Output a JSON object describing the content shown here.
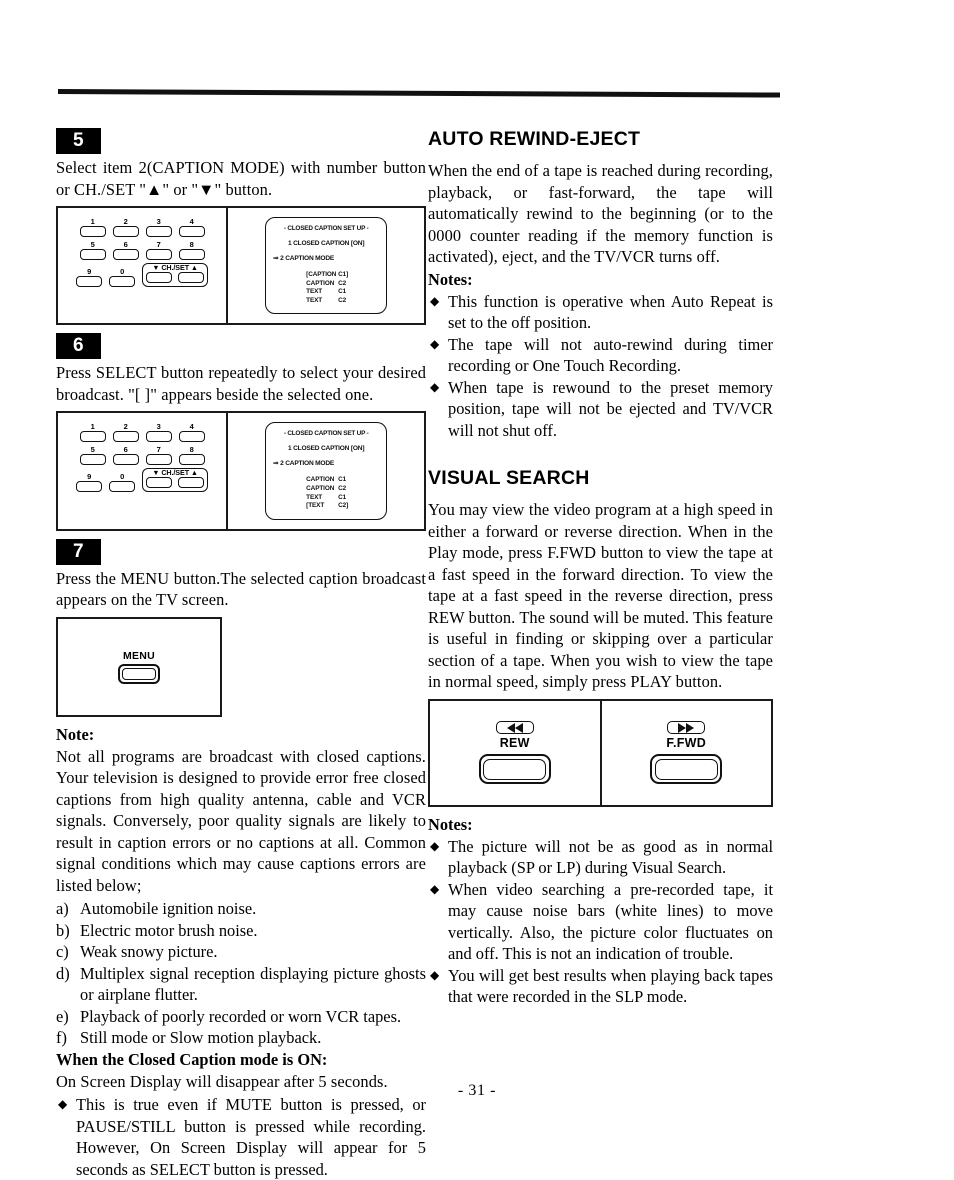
{
  "page": {
    "number_label": "- 31 -"
  },
  "left_column": {
    "step5": {
      "badge": "5",
      "text": "Select item 2(CAPTION MODE) with number button or CH./SET \"▲\" or \"▼\" button.",
      "figure": {
        "keypad": {
          "row1": [
            "1",
            "2",
            "3",
            "4"
          ],
          "row2": [
            "5",
            "6",
            "7",
            "8"
          ],
          "row3": [
            "9",
            "0"
          ],
          "chset_label": "▼ CH./SET ▲"
        },
        "tv_screen": {
          "title": "- CLOSED CAPTION SET UP -",
          "line1": "1 CLOSED CAPTION   [ON]",
          "line2": "⇒ 2 CAPTION MODE",
          "options": [
            {
              "name": "[CAPTION",
              "value": "C1]"
            },
            {
              "name": "CAPTION",
              "value": "C2"
            },
            {
              "name": "TEXT",
              "value": "C1"
            },
            {
              "name": "TEXT",
              "value": "C2"
            }
          ]
        }
      }
    },
    "step6": {
      "badge": "6",
      "text": "Press SELECT button repeatedly to select your desired broadcast. \"[ ]\" appears beside the selected one.",
      "figure": {
        "keypad": {
          "row1": [
            "1",
            "2",
            "3",
            "4"
          ],
          "row2": [
            "5",
            "6",
            "7",
            "8"
          ],
          "row3": [
            "9",
            "0"
          ],
          "chset_label": "▼ CH./SET ▲"
        },
        "tv_screen": {
          "title": "- CLOSED CAPTION SET UP -",
          "line1": "1 CLOSED CAPTION   [ON]",
          "line2": "⇒ 2 CAPTION MODE",
          "options": [
            {
              "name": "CAPTION",
              "value": "C1"
            },
            {
              "name": "CAPTION",
              "value": "C2"
            },
            {
              "name": "TEXT",
              "value": "C1"
            },
            {
              "name": "[TEXT",
              "value": "C2]"
            }
          ]
        }
      }
    },
    "step7": {
      "badge": "7",
      "text": "Press the MENU button.The selected caption broadcast appears on the TV screen.",
      "figure": {
        "menu_label": "MENU"
      }
    },
    "note": {
      "label": "Note:",
      "paragraph": "Not all programs are broadcast with closed captions. Your television is designed to provide error free closed captions from high quality antenna, cable and VCR signals. Conversely, poor quality signals are likely to result in caption errors or no captions at all. Common signal conditions which may cause captions errors are listed below;",
      "list": [
        {
          "marker": "a)",
          "text": "Automobile ignition noise."
        },
        {
          "marker": "b)",
          "text": "Electric motor brush noise."
        },
        {
          "marker": "c)",
          "text": "Weak snowy picture."
        },
        {
          "marker": "d)",
          "text": "Multiplex signal reception displaying picture ghosts or airplane flutter."
        },
        {
          "marker": "e)",
          "text": "Playback of poorly recorded or worn VCR tapes."
        },
        {
          "marker": "f)",
          "text": "Still mode or Slow motion playback."
        }
      ],
      "subhead": "When the Closed Caption mode is ON:",
      "subtext": "On Screen Display will disappear after 5 seconds.",
      "bullets": [
        "This is true even if MUTE button is pressed, or PAUSE/STILL button is pressed while recording. However, On Screen Display will appear for 5 seconds as SELECT button is pressed."
      ]
    }
  },
  "right_column": {
    "auto_rewind_eject": {
      "heading": "AUTO REWIND-EJECT",
      "paragraph": "When the end of a tape is reached during recording, playback, or fast-forward, the tape will automatically rewind to the beginning (or to the 0000 counter reading if the memory function is activated), eject, and the TV/VCR turns off.",
      "notes_label": "Notes:",
      "notes": [
        "This function is operative when Auto Repeat is set to the off position.",
        "The tape will not auto-rewind during timer recording or One Touch Recording.",
        "When tape is rewound to the preset memory position, tape will not be ejected and TV/VCR will not shut off."
      ]
    },
    "visual_search": {
      "heading": "VISUAL SEARCH",
      "paragraph": "You may view the video program at a high speed in either a forward or reverse direction. When in the Play mode, press F.FWD button to view the tape at a fast speed in the forward direction. To view the tape at a fast speed in the reverse direction, press REW button. The sound will be muted. This feature is useful in finding or skipping over a particular section of a tape. When you wish to view the tape in normal speed, simply press PLAY button.",
      "figure": {
        "rew_label": "REW",
        "ffwd_label": "F.FWD"
      },
      "notes_label": "Notes:",
      "notes": [
        "The picture will not be as good as in normal playback (SP or LP) during Visual Search.",
        "When video searching a pre-recorded tape, it may cause noise bars (white lines) to move vertically. Also, the picture color fluctuates on and off. This is not an indication of trouble.",
        "You will get best results when playing back tapes that were recorded in the SLP mode."
      ]
    }
  }
}
